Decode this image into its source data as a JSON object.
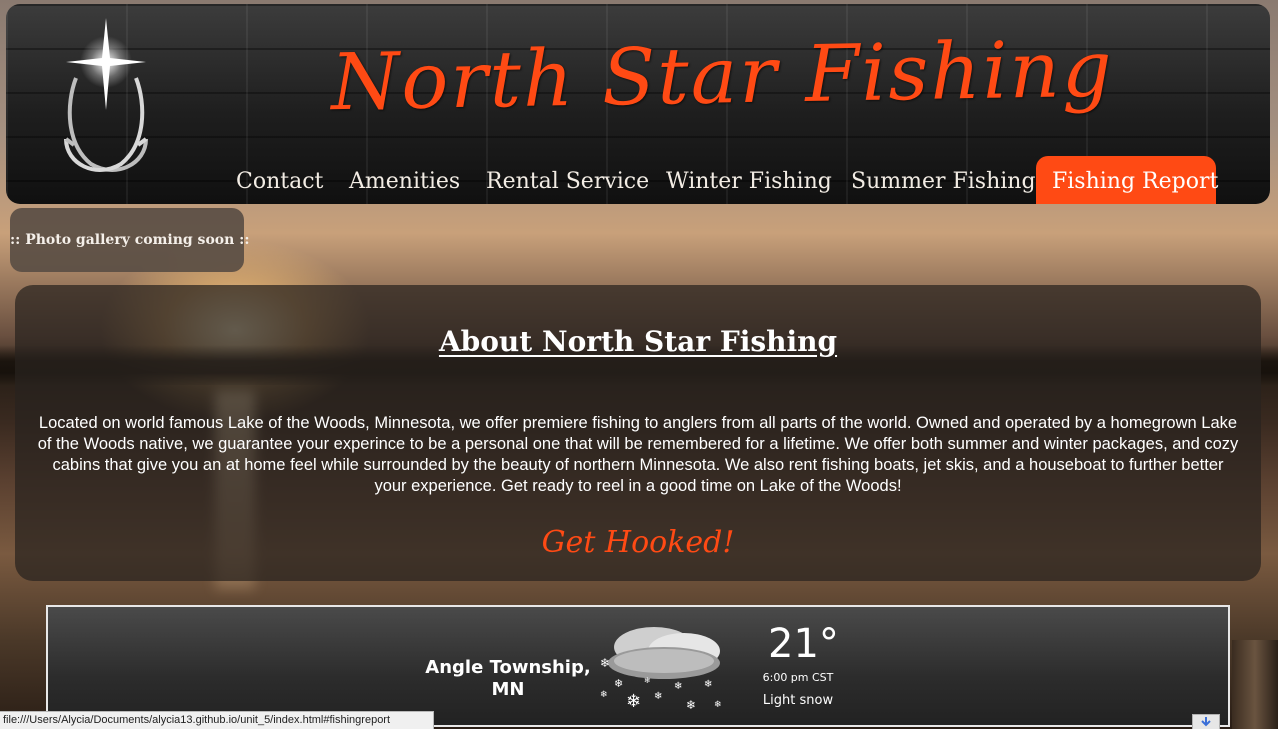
{
  "site": {
    "title": "North Star Fishing"
  },
  "nav": [
    {
      "label": "Contact",
      "active": false
    },
    {
      "label": "Amenities",
      "active": false
    },
    {
      "label": "Rental Service",
      "active": false
    },
    {
      "label": "Winter Fishing",
      "active": false
    },
    {
      "label": "Summer Fishing",
      "active": false
    },
    {
      "label": "Fishing Report",
      "active": true
    }
  ],
  "gallery_note": ":: Photo gallery coming soon ::",
  "about": {
    "title": "About North Star Fishing",
    "body": "Located on world famous Lake of the Woods, Minnesota, we offer premiere fishing to anglers from all parts of the world. Owned and operated by a homegrown Lake of the Woods native, we guarantee your experince to be a personal one that will be remembered for a lifetime. We offer both summer and winter packages, and cozy cabins that give you an at home feel while surrounded by the beauty of northern Minnesota. We also rent fishing boats, jet skis, and a houseboat to further better your experience. Get ready to reel in a good time on Lake of the Woods!",
    "tagline": "Get Hooked!"
  },
  "weather": {
    "location": "Angle Township, MN",
    "icon": "light-snow-icon",
    "temperature": "21°",
    "time": "6:00 pm CST",
    "condition": "Light snow"
  },
  "statusbar": {
    "url": "file:///Users/Alycia/Documents/alycia13.github.io/unit_5/index.html#fishingreport"
  },
  "colors": {
    "accent": "#ff4a14",
    "panel": "#28221e"
  }
}
